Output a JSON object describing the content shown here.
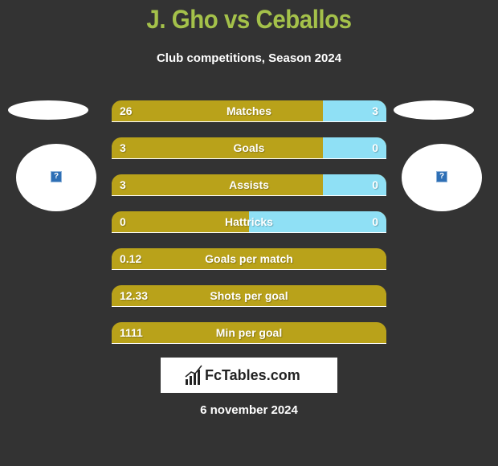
{
  "header": {
    "title": "J. Gho vs Ceballos",
    "subtitle": "Club competitions, Season 2024"
  },
  "players": {
    "left": {
      "logo_icon": "broken-image-icon"
    },
    "right": {
      "logo_icon": "broken-image-icon"
    }
  },
  "colors": {
    "title": "#a4c14a",
    "left_bar": "#b9a21a",
    "right_bar": "#8fe0f5",
    "background": "#333333"
  },
  "stats": [
    {
      "label": "Matches",
      "left": "26",
      "right": "3",
      "right_share": 0.23
    },
    {
      "label": "Goals",
      "left": "3",
      "right": "0",
      "right_share": 0.23
    },
    {
      "label": "Assists",
      "left": "3",
      "right": "0",
      "right_share": 0.23
    },
    {
      "label": "Hattricks",
      "left": "0",
      "right": "0",
      "right_share": 0.5
    },
    {
      "label": "Goals per match",
      "left": "0.12",
      "right": "",
      "right_share": 0
    },
    {
      "label": "Shots per goal",
      "left": "12.33",
      "right": "",
      "right_share": 0
    },
    {
      "label": "Min per goal",
      "left": "1111",
      "right": "",
      "right_share": 0
    }
  ],
  "brand": {
    "name": "FcTables.com",
    "icon": "bar-chart-icon"
  },
  "footer": {
    "date": "6 november 2024"
  }
}
